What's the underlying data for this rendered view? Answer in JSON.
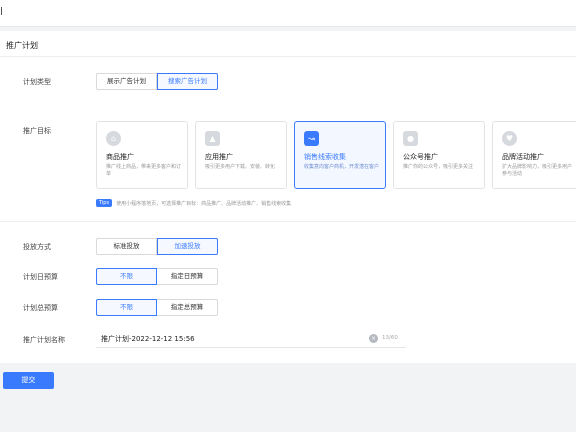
{
  "page": {
    "panel_title": "推广计划",
    "submit_label": "提交"
  },
  "plan_type": {
    "label": "计划类型",
    "options": [
      "展示广告计划",
      "搜索广告计划"
    ],
    "selected": "搜索广告计划"
  },
  "goal": {
    "label": "推广目标",
    "cards": [
      {
        "title": "商品推广",
        "desc": "推广线上商品，带来更多客户和订单",
        "icon": "bag-icon"
      },
      {
        "title": "应用推广",
        "desc": "吸引更多用户下载、安装、转化",
        "icon": "app-icon"
      },
      {
        "title": "销售线索收集",
        "desc": "收集意向客户商机，开发潜在客户",
        "icon": "link-icon"
      },
      {
        "title": "公众号推广",
        "desc": "推广你的公众号，吸引更多关注",
        "icon": "person-icon"
      },
      {
        "title": "品牌活动推广",
        "desc": "扩大品牌影响力，吸引更多用户参与活动",
        "icon": "heart-icon"
      }
    ],
    "selected": "销售线索收集",
    "tips_tag": "Tips",
    "tips_text": "使用小程序落地页，可选择推广目标：商品推广、品牌活动推广、销售线索收集"
  },
  "delivery": {
    "label": "投放方式",
    "options": [
      "标准投放",
      "加速投放"
    ],
    "selected": "加速投放"
  },
  "daily_budget": {
    "label": "计划日预算",
    "options": [
      "不限",
      "指定日预算"
    ],
    "selected": "不限"
  },
  "total_budget": {
    "label": "计划总预算",
    "options": [
      "不限",
      "指定总预算"
    ],
    "selected": "不限"
  },
  "plan_name": {
    "label": "推广计划名称",
    "value": "推广计划-2022-12-12 15:56",
    "count": "13/60"
  },
  "colors": {
    "accent": "#3a7afe",
    "background": "#f2f3f5"
  }
}
